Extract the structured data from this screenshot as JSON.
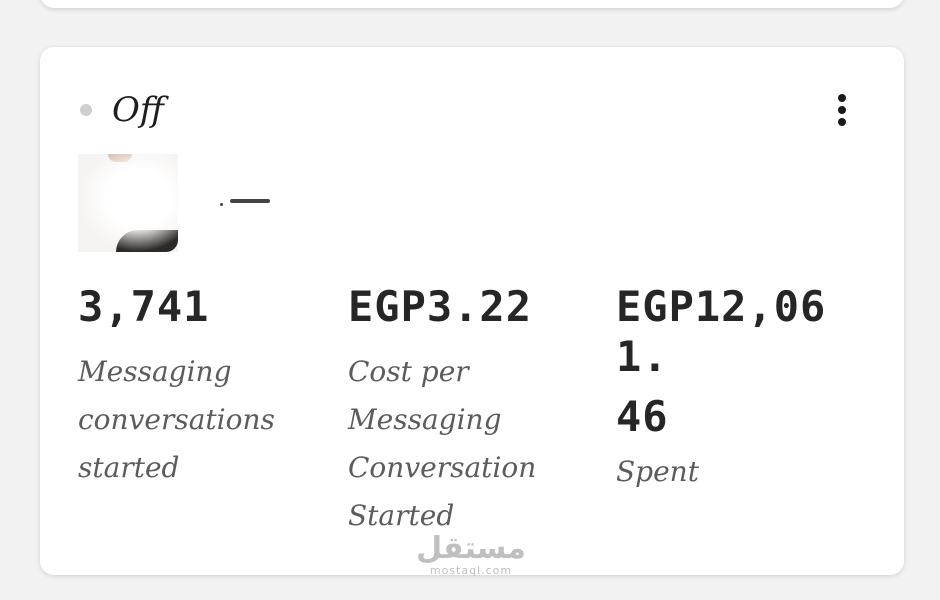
{
  "campaign": {
    "status": "Off",
    "menu_icon": "more-vertical-icon",
    "colors": {
      "status_dot": "#cfcfcf",
      "value_text": "#262626",
      "label_text": "#5c5c5c"
    }
  },
  "metrics": [
    {
      "value": "3,741",
      "label_lines": [
        "Messaging",
        "conversations",
        "started"
      ]
    },
    {
      "value": "EGP3.22",
      "label_lines": [
        "Cost per",
        "Messaging",
        "Conversation",
        "Started"
      ]
    },
    {
      "value_lines": [
        "EGP12,061.",
        "46"
      ],
      "label_lines": [
        "Spent"
      ]
    }
  ],
  "watermark": {
    "main": "مستقل",
    "sub": "mostaql.com"
  }
}
